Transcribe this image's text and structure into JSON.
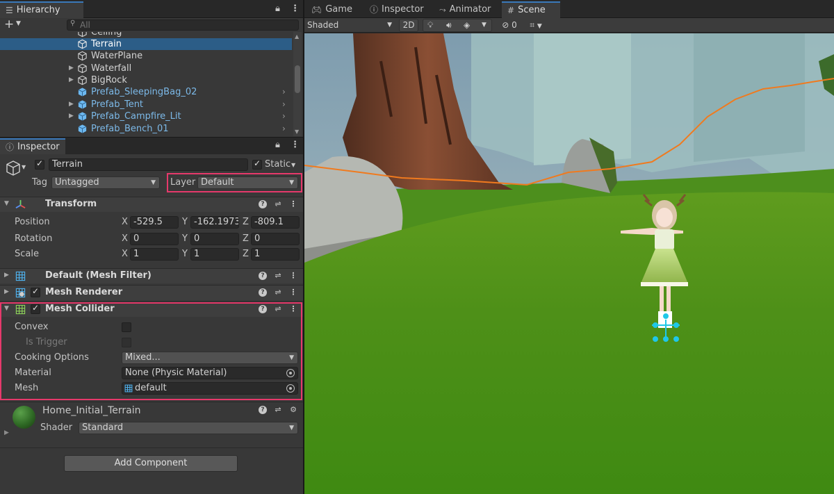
{
  "hierarchy": {
    "tab_label": "Hierarchy",
    "search_placeholder": "All",
    "items": [
      {
        "label": "Ceiling",
        "prefab": false
      },
      {
        "label": "Terrain",
        "prefab": false
      },
      {
        "label": "WaterPlane",
        "prefab": false
      },
      {
        "label": "Waterfall",
        "prefab": false
      },
      {
        "label": "BigRock",
        "prefab": false
      },
      {
        "label": "Prefab_SleepingBag_02",
        "prefab": true
      },
      {
        "label": "Prefab_Tent",
        "prefab": true
      },
      {
        "label": "Prefab_Campfire_Lit",
        "prefab": true
      },
      {
        "label": "Prefab_Bench_01",
        "prefab": true
      }
    ]
  },
  "tabs": {
    "game": "Game",
    "inspector": "Inspector",
    "animator": "Animator",
    "scene": "Scene"
  },
  "scene_toolbar": {
    "shading_mode": "Shaded",
    "mode_2d": "2D",
    "hidden_count": "0"
  },
  "inspector": {
    "tab_label": "Inspector",
    "object_name": "Terrain",
    "static_label": "Static",
    "tag_label": "Tag",
    "tag_value": "Untagged",
    "layer_label": "Layer",
    "layer_value": "Default",
    "transform": {
      "title": "Transform",
      "position_label": "Position",
      "rotation_label": "Rotation",
      "scale_label": "Scale",
      "axis_x": "X",
      "axis_y": "Y",
      "axis_z": "Z",
      "position": {
        "x": "-529.5",
        "y": "-162.1973",
        "z": "-809.1"
      },
      "rotation": {
        "x": "0",
        "y": "0",
        "z": "0"
      },
      "scale": {
        "x": "1",
        "y": "1",
        "z": "1"
      }
    },
    "mesh_filter_title": "Default (Mesh Filter)",
    "mesh_renderer_title": "Mesh Renderer",
    "mesh_collider": {
      "title": "Mesh Collider",
      "convex_label": "Convex",
      "is_trigger_label": "Is Trigger",
      "cooking_options_label": "Cooking Options",
      "cooking_options_value": "Mixed...",
      "material_label": "Material",
      "material_value": "None (Physic Material)",
      "mesh_label": "Mesh",
      "mesh_value": "default"
    },
    "material": {
      "name": "Home_Initial_Terrain",
      "shader_label": "Shader",
      "shader_value": "Standard"
    },
    "add_component_label": "Add Component"
  },
  "colors": {
    "selection": "#2c5d87",
    "highlight": "#e6396b",
    "prefab_text": "#7cb9e8",
    "tab_accent": "#3a79bb"
  }
}
